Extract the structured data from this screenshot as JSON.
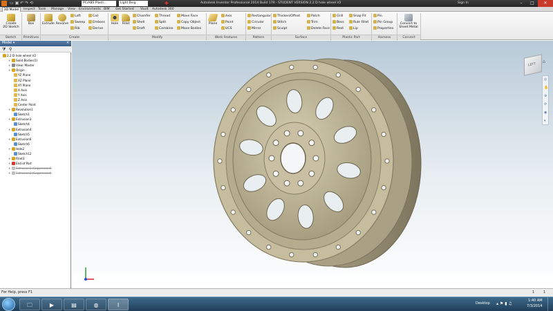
{
  "window": {
    "title": "Autodesk Inventor Professional 2014 Build 179 - STUDENT VERSION   2.2 D hole wheel V2",
    "quick_access_material": "PC/ABS Plasti...",
    "quick_access_appearance": "Light Beig",
    "sign_in": "Sign In"
  },
  "ribbon_tabs": [
    "3D Model",
    "Inspect",
    "Tools",
    "Manage",
    "View",
    "Environments",
    "BIM",
    "Get Started",
    "Vault",
    "Autodesk 360"
  ],
  "ribbon": {
    "sketch": {
      "create_2d_sketch": "Create\n2D Sketch",
      "label": "Sketch"
    },
    "primitives": {
      "box": "Box",
      "label": "Primitives"
    },
    "create": {
      "extrude": "Extrude",
      "revolve": "Revolve",
      "loft": "Loft",
      "sweep": "Sweep",
      "rib": "Rib",
      "coil": "Coil",
      "emboss": "Emboss",
      "derive": "Derive",
      "label": "Create"
    },
    "modify": {
      "hole": "Hole",
      "fillet": "Fillet",
      "chamfer": "Chamfer",
      "shell": "Shell",
      "draft": "Draft",
      "thread": "Thread",
      "split": "Split",
      "combine": "Combine",
      "move_face": "Move Face",
      "copy_object": "Copy Object",
      "move_bodies": "Move Bodies",
      "label": "Modify"
    },
    "work_features": {
      "plane": "Plane",
      "axis": "Axis",
      "point": "Point",
      "ucs": "UCS",
      "label": "Work Features"
    },
    "pattern": {
      "rectangular": "Rectangular",
      "circular": "Circular",
      "mirror": "Mirror",
      "label": "Pattern"
    },
    "surface": {
      "thicken_offset": "Thicken/Offset",
      "stitch": "Stitch",
      "sculpt": "Sculpt",
      "patch": "Patch",
      "trim": "Trim",
      "delete_face": "Delete Face",
      "label": "Surface"
    },
    "plastic_part": {
      "grill": "Grill",
      "boss": "Boss",
      "rest": "Rest",
      "snap_fit": "Snap Fit",
      "rule_fillet": "Rule Fillet",
      "lip": "Lip",
      "label": "Plastic Part"
    },
    "harness": {
      "pin": "Pin",
      "pin_group": "Pin Group",
      "properties": "Properties",
      "label": "Harness"
    },
    "convert": {
      "convert_to_sheet_metal": "Convert to\nSheet Metal",
      "label": "Convert"
    }
  },
  "browser": {
    "header": "Model",
    "nodes": [
      {
        "label": "2.2 D hole wheel V2",
        "depth": 0,
        "icon": "part-icon",
        "color": "#d9a521"
      },
      {
        "label": "Solid Bodies(1)",
        "depth": 1,
        "icon": "folder-icon",
        "color": "#d9a521"
      },
      {
        "label": "View: Master",
        "depth": 1,
        "icon": "view-icon",
        "color": "#8a8a8a"
      },
      {
        "label": "Origin",
        "depth": 1,
        "icon": "folder-icon",
        "color": "#d9a521"
      },
      {
        "label": "YZ Plane",
        "depth": 2,
        "icon": "plane-icon",
        "color": "#e2b64a"
      },
      {
        "label": "XZ Plane",
        "depth": 2,
        "icon": "plane-icon",
        "color": "#e2b64a"
      },
      {
        "label": "XY Plane",
        "depth": 2,
        "icon": "plane-icon",
        "color": "#e2b64a"
      },
      {
        "label": "X Axis",
        "depth": 2,
        "icon": "axis-icon",
        "color": "#e2b64a"
      },
      {
        "label": "Y Axis",
        "depth": 2,
        "icon": "axis-icon",
        "color": "#e2b64a"
      },
      {
        "label": "Z Axis",
        "depth": 2,
        "icon": "axis-icon",
        "color": "#e2b64a"
      },
      {
        "label": "Center Point",
        "depth": 2,
        "icon": "point-icon",
        "color": "#e2b64a"
      },
      {
        "label": "Revolution1",
        "depth": 1,
        "icon": "revolve-icon",
        "color": "#d9a521"
      },
      {
        "label": "Sketch1",
        "depth": 2,
        "icon": "sketch-icon",
        "color": "#5a8fd0"
      },
      {
        "label": "Extrusion3",
        "depth": 1,
        "icon": "extrude-icon",
        "color": "#d9a521"
      },
      {
        "label": "Sketch4",
        "depth": 2,
        "icon": "sketch-icon",
        "color": "#5a8fd0"
      },
      {
        "label": "Extrusion4",
        "depth": 1,
        "icon": "extrude-icon",
        "color": "#d9a521"
      },
      {
        "label": "Sketch5",
        "depth": 2,
        "icon": "sketch-icon",
        "color": "#5a8fd0"
      },
      {
        "label": "Extrusion6",
        "depth": 1,
        "icon": "extrude-icon",
        "color": "#d9a521"
      },
      {
        "label": "Sketch6",
        "depth": 2,
        "icon": "sketch-icon",
        "color": "#5a8fd0"
      },
      {
        "label": "Hole2",
        "depth": 1,
        "icon": "hole-icon",
        "color": "#d9a521"
      },
      {
        "label": "Sketch12",
        "depth": 2,
        "icon": "sketch-icon",
        "color": "#5a8fd0"
      },
      {
        "label": "Fillet3",
        "depth": 1,
        "icon": "fillet-icon",
        "color": "#d9a521"
      },
      {
        "label": "End of Part",
        "depth": 1,
        "icon": "end-of-part-icon",
        "color": "#d63b2a"
      },
      {
        "label": "Extrusion1 (Suppressed)",
        "depth": 1,
        "icon": "extrude-icon",
        "color": "#c0c0c0",
        "suppressed": true
      },
      {
        "label": "Extrusion2 (Suppressed)",
        "depth": 1,
        "icon": "extrude-icon",
        "color": "#c0c0c0",
        "suppressed": true
      }
    ]
  },
  "viewcube": {
    "face_label": "LEFT"
  },
  "status": {
    "help_text": "For Help, press F1",
    "count_a": "1",
    "count_b": "1"
  },
  "taskbar": {
    "desktop_label": "Desktop",
    "time": "1:40 AM",
    "date": "7/3/2014"
  },
  "colors": {
    "ribbon_bg": "#f2f2f2",
    "browser_header": "#4a6f99",
    "wheel": "#c4bb9c",
    "viewport_top": "#b8cad8"
  }
}
